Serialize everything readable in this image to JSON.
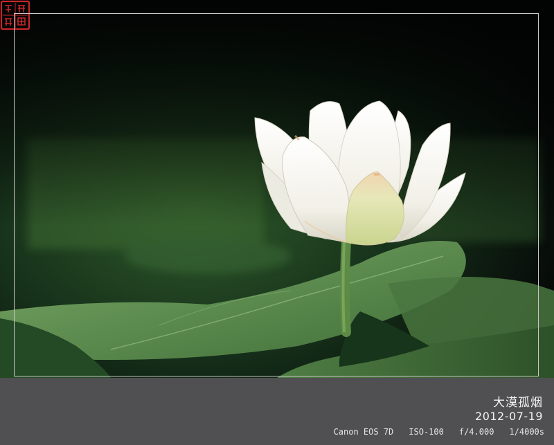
{
  "photo": {
    "subject": "white-lotus-flower-icon",
    "seal_icon": "red-seal-stamp-icon",
    "seal_text": "大漠孤烟",
    "colors": {
      "background_dark": "#06080a",
      "foliage_green": "#2f5a2a",
      "leaf_green": "#5f8f4f",
      "petal_white": "#f4f2ea",
      "petal_tint": "#e9c9a8",
      "seal_red": "#c8262a",
      "frame": "#c9c9c9",
      "caption_bar": "#505052"
    }
  },
  "caption": {
    "author": "大漠孤烟",
    "date": "2012-07-19",
    "camera": "Canon EOS 7D",
    "iso": "ISO-100",
    "aperture": "f/4.000",
    "shutter": "1/4000s"
  }
}
